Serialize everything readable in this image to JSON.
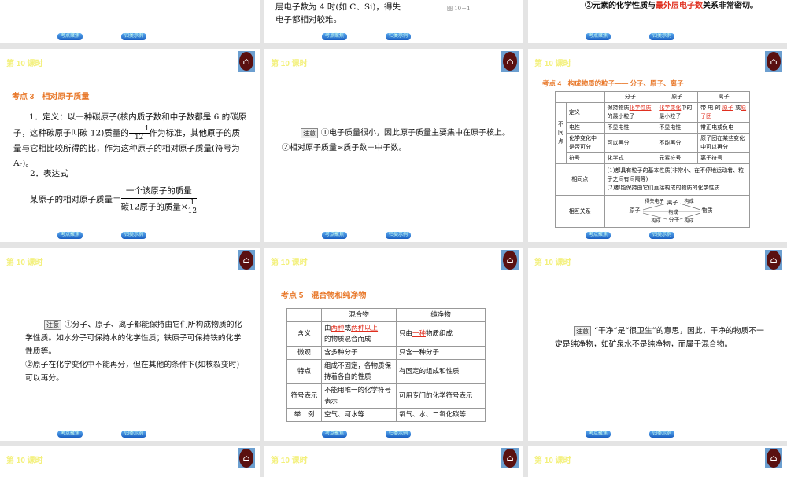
{
  "header": {
    "lesson": "第 10 课时"
  },
  "nav": {
    "prev": "考点聚焦",
    "next": "归类示例"
  },
  "top": {
    "mid_line1": "层电子数为 4 时(如 C、Si)，得失",
    "mid_line2": "电子都相对较难。",
    "fig": "图 10－1",
    "right_pre": "②元素的化学性质与",
    "right_blank": "最外层电子数",
    "right_post": "关系非常密切。"
  },
  "s3": {
    "title": "考点 3　相对原子质量",
    "p1a": "1．定义：以一种碳原子(核内质子数和中子数都是 6 的碳原子，这种碳原子叫碳 12)质量的",
    "p1frac_n": "1",
    "p1frac_d": "12",
    "p1b": "作为标准，其他原子的质量与它相比较所得的比，作为这种原子的相对原子质量(符号为 Aᵣ)。",
    "p2": "2．表达式",
    "lhs": "某原子的相对原子质量＝",
    "num": "一个该原子的质量",
    "den": "碳12原子的质量×",
    "den_n": "1",
    "den_d": "12"
  },
  "n1": {
    "tag": "注意",
    "l1": "①电子质量很小，因此原子质量主要集中在原子核上。",
    "l2": "②相对原子质量≈质子数＋中子数。"
  },
  "s4": {
    "title": "考点 4　构成物质的粒子—— 分子、原子、离子",
    "cols": [
      "分子",
      "原子",
      "离子"
    ],
    "diff": "不同点",
    "r_def": "定义",
    "def_m_pre": "保持物质",
    "def_m_blank": "化学性质",
    "def_m_post": "的最小粒子",
    "def_a_blank": "化学变化",
    "def_a_post": "中的最小粒子",
    "def_i_pre": "带 电 的",
    "def_i_b1": "原子",
    "def_i_or": "或",
    "def_i_b2": "原子团",
    "r_charge": "电性",
    "charge": [
      "不显电性",
      "不显电性",
      "带正电或负电"
    ],
    "r_div": "化学变化中是否可分",
    "div": [
      "可以再分",
      "不能再分",
      "原子团在某些变化中可以再分"
    ],
    "r_sym": "符号",
    "sym": [
      "化学式",
      "元素符号",
      "离子符号"
    ],
    "same": "相同点",
    "same1": "(1)都具有粒子的基本性质(非常小、在不停地运动着、粒子之间有间隔等)",
    "same2": "(2)都能保持由它们直接构成的物质的化学性质",
    "rel": "相互关系",
    "rel_atom": "原子",
    "rel_ion": "离子",
    "rel_mol": "分子",
    "rel_matter": "物质",
    "rel_gain": "得失电子",
    "rel_c1": "构成",
    "rel_c2": "构成",
    "rel_c3": "构成",
    "rel_c4": "构成"
  },
  "n2": {
    "tag": "注意",
    "l1": "①分子、原子、离子都能保持由它们所构成物质的化学性质。如水分子可保持水的化学性质；铁原子可保持铁的化学性质等。",
    "l2": "②原子在化学变化中不能再分，但在其他的条件下(如核裂变时)可以再分。"
  },
  "s5": {
    "title": "考点 5　混合物和纯净物",
    "cols": [
      "混合物",
      "纯净物"
    ],
    "r1": "含义",
    "r1m_a": "由",
    "r1m_b1": "两种",
    "r1m_or": "或",
    "r1m_b2": "两种以上",
    "r1m_c": "的物质混合而成",
    "r1p_a": "只由",
    "r1p_b": "一种",
    "r1p_c": "物质组成",
    "r2": "微观",
    "r2m": "含多种分子",
    "r2p": "只含一种分子",
    "r3": "特点",
    "r3m": "组成不固定，各物质保持着各自的性质",
    "r3p": "有固定的组成和性质",
    "r4": "符号表示",
    "r4m": "不能用唯一的化学符号表示",
    "r4p": "可用专门的化学符号表示",
    "r5": "举　例",
    "r5m": "空气、河水等",
    "r5p": "氧气、水、二氧化碳等"
  },
  "n3": {
    "tag": "注意",
    "l1": "“干净”是“很卫生”的意思，因此，干净的物质不一定是纯净物，如矿泉水不是纯净物，而属于混合物。"
  }
}
